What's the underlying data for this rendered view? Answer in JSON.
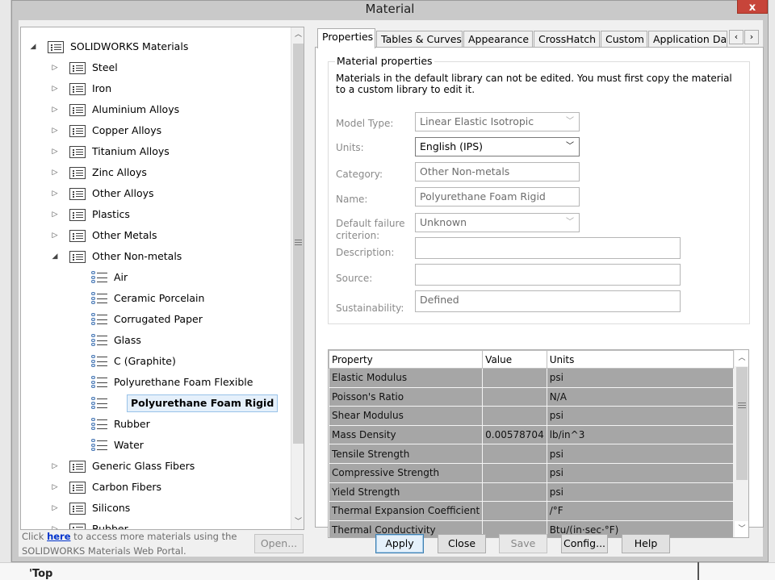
{
  "window": {
    "title": "Material",
    "close_label": "x"
  },
  "background": {
    "bottom_text": "'Top"
  },
  "tree": {
    "root": "SOLIDWORKS Materials",
    "items": [
      {
        "label": "Steel",
        "type": "folder",
        "expanded": false
      },
      {
        "label": "Iron",
        "type": "folder",
        "expanded": false
      },
      {
        "label": "Aluminium Alloys",
        "type": "folder",
        "expanded": false
      },
      {
        "label": "Copper Alloys",
        "type": "folder",
        "expanded": false
      },
      {
        "label": "Titanium Alloys",
        "type": "folder",
        "expanded": false
      },
      {
        "label": "Zinc Alloys",
        "type": "folder",
        "expanded": false
      },
      {
        "label": "Other Alloys",
        "type": "folder",
        "expanded": false
      },
      {
        "label": "Plastics",
        "type": "folder",
        "expanded": false
      },
      {
        "label": "Other Metals",
        "type": "folder",
        "expanded": false
      },
      {
        "label": "Other Non-metals",
        "type": "folder",
        "expanded": true
      },
      {
        "label": "Air",
        "type": "material"
      },
      {
        "label": "Ceramic Porcelain",
        "type": "material"
      },
      {
        "label": "Corrugated Paper",
        "type": "material"
      },
      {
        "label": "Glass",
        "type": "material"
      },
      {
        "label": "C (Graphite)",
        "type": "material"
      },
      {
        "label": "Polyurethane Foam Flexible",
        "type": "material"
      },
      {
        "label": "Polyurethane Foam Rigid",
        "type": "material",
        "selected": true
      },
      {
        "label": "Rubber",
        "type": "material"
      },
      {
        "label": "Water",
        "type": "material"
      },
      {
        "label": "Generic Glass Fibers",
        "type": "folder",
        "expanded": false
      },
      {
        "label": "Carbon Fibers",
        "type": "folder",
        "expanded": false
      },
      {
        "label": "Silicons",
        "type": "folder",
        "expanded": false
      },
      {
        "label": "Rubber",
        "type": "folder",
        "expanded": false
      }
    ]
  },
  "portal": {
    "prefix": "Click ",
    "link": "here",
    "suffix": " to access more materials using the SOLIDWORKS Materials Web Portal."
  },
  "buttons": {
    "open": "Open...",
    "apply": "Apply",
    "close": "Close",
    "save": "Save",
    "config": "Config...",
    "help": "Help"
  },
  "tabs": [
    "Properties",
    "Tables & Curves",
    "Appearance",
    "CrossHatch",
    "Custom",
    "Application Dat"
  ],
  "tab_nav": {
    "prev": "‹",
    "next": "›"
  },
  "properties": {
    "group_title": "Material properties",
    "note": "Materials in the default library can not be edited. You must first copy the material to a custom library to edit it.",
    "model_type_label": "Model Type:",
    "model_type": "Linear Elastic Isotropic",
    "units_label": "Units:",
    "units": "English (IPS)",
    "category_label": "Category:",
    "category": "Other Non-metals",
    "name_label": "Name:",
    "name": "Polyurethane Foam Rigid",
    "failure_label_1": "Default failure",
    "failure_label_2": "criterion:",
    "failure": "Unknown",
    "description_label": "Description:",
    "description": "",
    "source_label": "Source:",
    "source": "",
    "sustainability_label": "Sustainability:",
    "sustainability": "Defined"
  },
  "property_table": {
    "headers": [
      "Property",
      "Value",
      "Units"
    ],
    "rows": [
      [
        "Elastic Modulus",
        "",
        "psi"
      ],
      [
        "Poisson's Ratio",
        "",
        "N/A"
      ],
      [
        "Shear Modulus",
        "",
        "psi"
      ],
      [
        "Mass Density",
        "0.00578704",
        "lb/in^3"
      ],
      [
        "Tensile Strength",
        "",
        "psi"
      ],
      [
        "Compressive Strength",
        "",
        "psi"
      ],
      [
        "Yield Strength",
        "",
        "psi"
      ],
      [
        "Thermal Expansion Coefficient",
        "",
        "/°F"
      ],
      [
        "Thermal Conductivity",
        "",
        "Btu/(in·sec·°F)"
      ]
    ]
  },
  "colors": {
    "selection": "#e5f0fb",
    "table_cell": "#a6a6a6",
    "link": "#0033cc",
    "close_button": "#c7453a"
  }
}
